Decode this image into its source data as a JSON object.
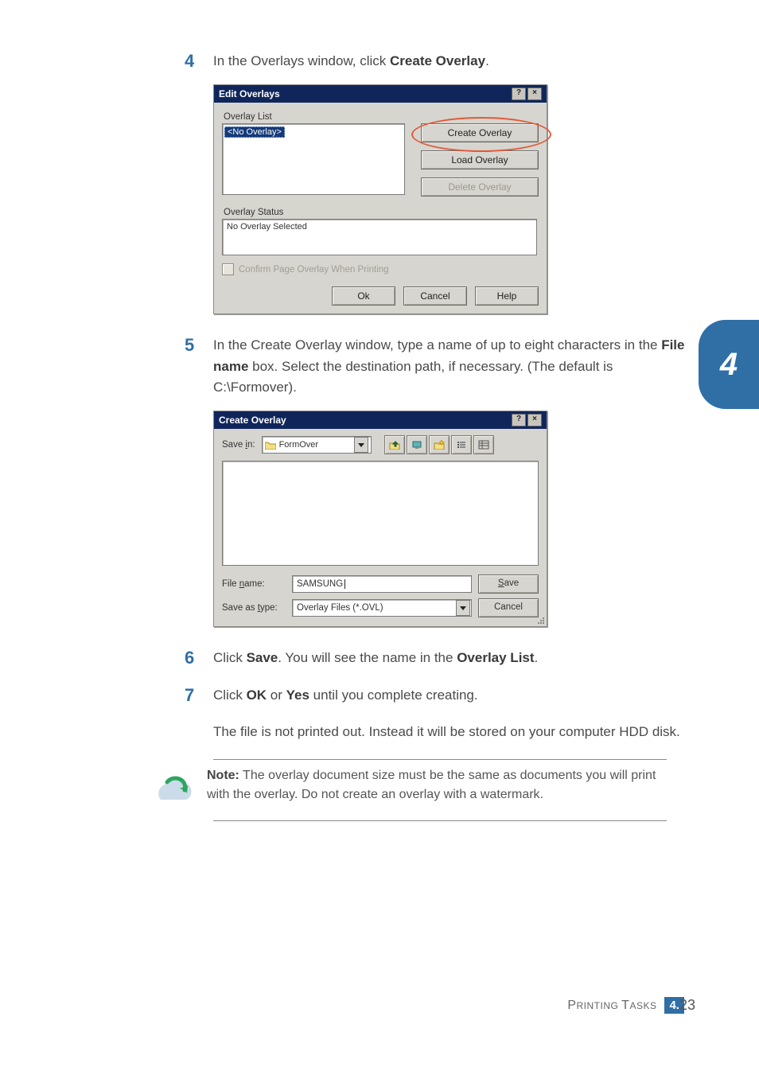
{
  "steps": {
    "4": {
      "num": "4",
      "text_before": "In the Overlays window, click ",
      "bold": "Create Overlay",
      "text_after": "."
    },
    "5": {
      "num": "5",
      "line1a": "In the Create Overlay window, type a name of up to eight characters in the ",
      "bold1": "File name",
      "line1b": " box. Select the destination path, if necessary. (The default is C:\\Formover)."
    },
    "6": {
      "num": "6",
      "a": "Click ",
      "b1": "Save",
      "b": ". You will see the name in the ",
      "b2": "Overlay List",
      "c": "."
    },
    "7": {
      "num": "7",
      "a": "Click ",
      "b1": "OK",
      "mid": " or ",
      "b2": "Yes",
      "b": " until you complete creating.",
      "para2": "The file is not printed out. Instead it will be stored on your computer HDD disk."
    }
  },
  "edit_overlays_dialog": {
    "title": "Edit Overlays",
    "help_btn": "?",
    "close_btn": "×",
    "overlay_list_label": "Overlay List",
    "list_selected": "<No Overlay>",
    "buttons": {
      "create": "Create Overlay",
      "load": "Load Overlay",
      "delete": "Delete Overlay"
    },
    "overlay_status_label": "Overlay Status",
    "status_text": "No Overlay Selected",
    "confirm_checkbox": "Confirm Page Overlay When Printing",
    "ok": "Ok",
    "cancel": "Cancel",
    "help": "Help"
  },
  "create_overlay_dialog": {
    "title": "Create Overlay",
    "help_btn": "?",
    "close_btn": "×",
    "save_in_label": "Save in:",
    "save_in_value": "FormOver",
    "file_name_label_prefix": "File ",
    "file_name_label_ul": "n",
    "file_name_label_suffix": "ame:",
    "file_name_value": "SAMSUNG",
    "save_as_type_label_prefix": "Save as ",
    "save_as_type_label_ul": "t",
    "save_as_type_label_suffix": "ype:",
    "save_as_type_value": "Overlay Files (*.OVL)",
    "save_btn_ul": "S",
    "save_btn_suffix": "ave",
    "cancel_btn": "Cancel"
  },
  "note": {
    "label": "Note:",
    "text": " The overlay document size must be the same as documents you will print with the overlay. Do not create an overlay with a watermark."
  },
  "side_tab": "4",
  "footer": {
    "section_a": "P",
    "section_b": "RINTING ",
    "section_c": "T",
    "section_d": "ASKS",
    "page_major": "4.",
    "page_minor": "23"
  }
}
